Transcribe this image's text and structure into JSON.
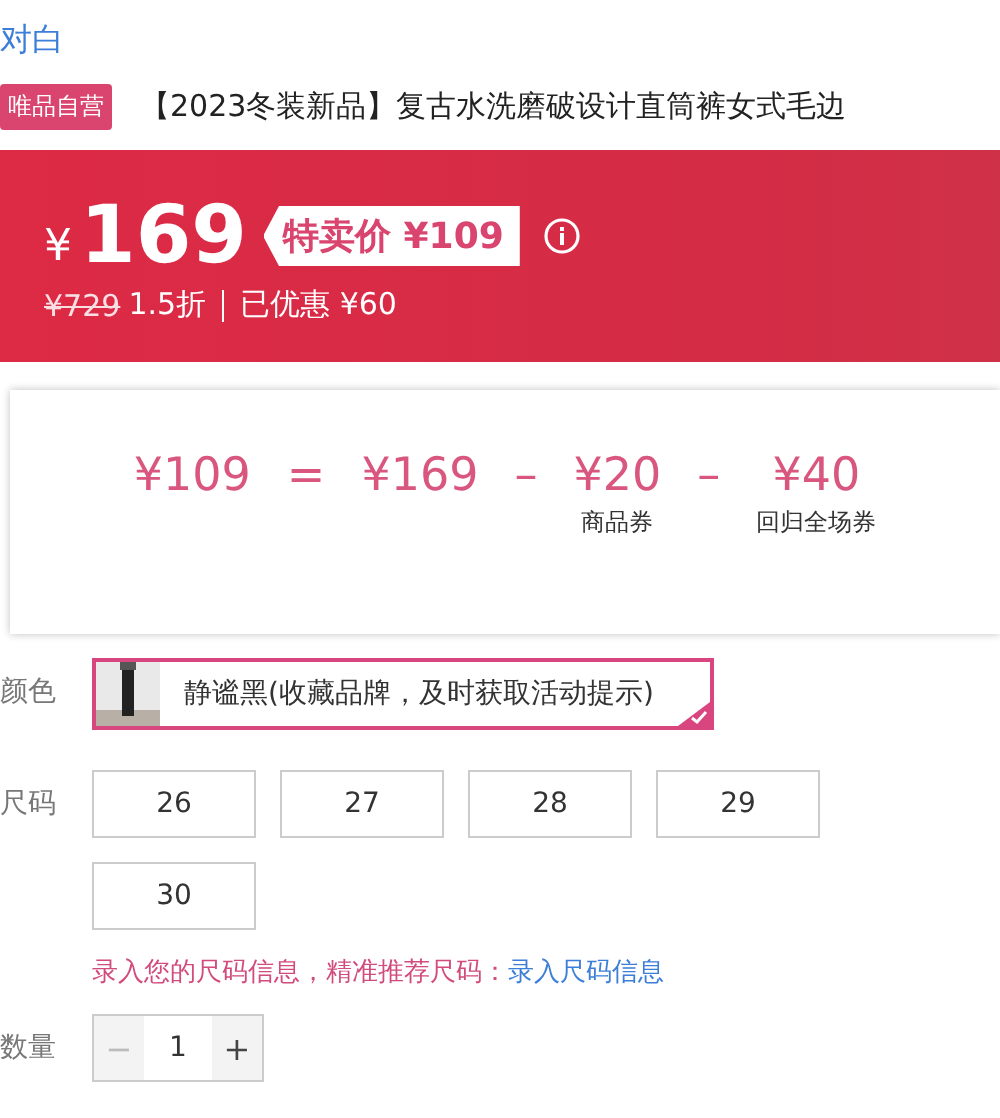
{
  "brand": "对白",
  "product": {
    "badge": "唯品自营",
    "title": "【2023冬装新品】复古水洗磨破设计直筒裤女式毛边"
  },
  "price": {
    "currency": "¥",
    "current": "169",
    "special_label": "特卖价",
    "special_price": "¥109",
    "original": "¥729",
    "discount": "1.5折",
    "saved": "已优惠 ¥60"
  },
  "breakdown": {
    "items": [
      {
        "amount": "¥109",
        "operator": "="
      },
      {
        "amount": "¥169",
        "operator": "–"
      },
      {
        "amount": "¥20",
        "operator": "–",
        "caption": "商品券"
      },
      {
        "amount": "¥40",
        "caption": "回归全场券"
      }
    ]
  },
  "color": {
    "label": "颜色",
    "options": [
      {
        "name": "静谧黑(收藏品牌，及时获取活动提示)",
        "selected": true
      }
    ]
  },
  "size": {
    "label": "尺码",
    "options": [
      {
        "name": "26",
        "selected": false
      },
      {
        "name": "27",
        "selected": false
      },
      {
        "name": "28",
        "selected": false
      },
      {
        "name": "29",
        "selected": false
      },
      {
        "name": "30",
        "selected": false
      }
    ],
    "hint": "录入您的尺码信息，精准推荐尺码：",
    "hint_link": "录入尺码信息"
  },
  "quantity": {
    "label": "数量",
    "minus": "−",
    "value": "1",
    "plus": "+",
    "minus_disabled": true
  }
}
